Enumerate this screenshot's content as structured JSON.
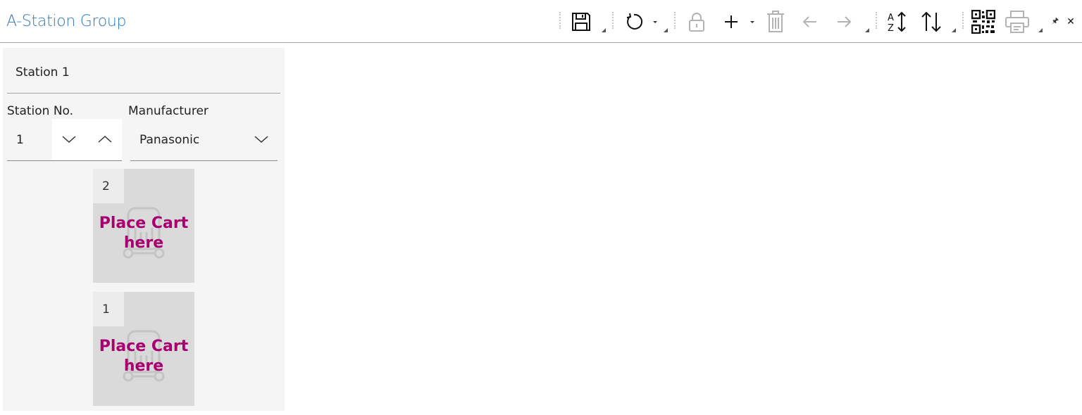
{
  "window": {
    "title": "A-Station Group"
  },
  "toolbar": {
    "icons": [
      "save-icon",
      "refresh-icon",
      "lock-icon",
      "plus-icon",
      "trash-icon",
      "arrow-left-icon",
      "arrow-right-icon",
      "sort-az-icon",
      "sort-updown-icon",
      "qr-code-icon",
      "printer-icon",
      "pin-icon",
      "close-icon"
    ],
    "pin_glyph": "🖈",
    "close_glyph": "✕"
  },
  "station": {
    "title": "Station 1",
    "station_no_label": "Station No.",
    "station_no_value": "1",
    "manufacturer_label": "Manufacturer",
    "manufacturer_value": "Panasonic"
  },
  "slots": [
    {
      "number": "2",
      "text": "Place Cart here"
    },
    {
      "number": "1",
      "text": "Place Cart here"
    }
  ],
  "colors": {
    "title_blue": "#2f7bbd",
    "slot_text": "#a8006f",
    "panel_bg": "#f5f5f5",
    "slot_bg": "#dadada"
  }
}
